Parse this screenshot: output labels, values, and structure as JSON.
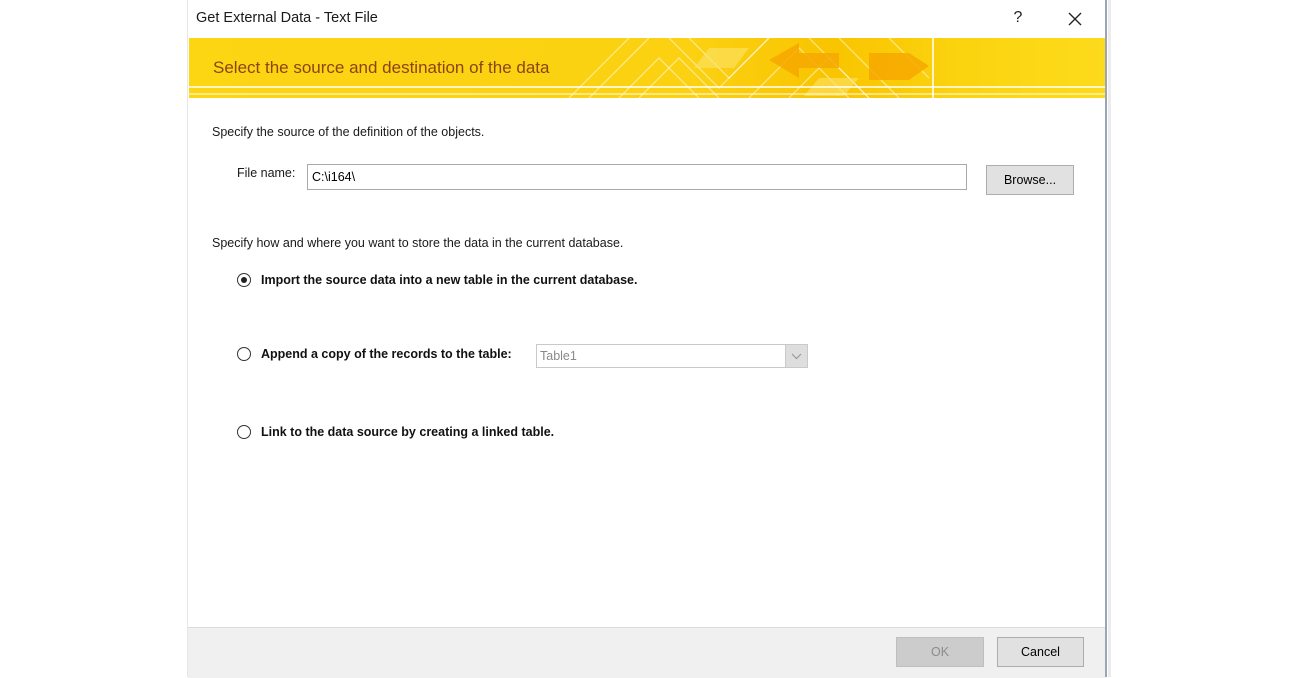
{
  "window": {
    "title": "Get External Data - Text File",
    "help_label": "?"
  },
  "banner": {
    "title": "Select the source and destination of the data"
  },
  "source": {
    "instruction": "Specify the source of the definition of the objects.",
    "file_label": "File name:",
    "file_value": "C:\\i164\\",
    "browse_label": "Browse..."
  },
  "destination": {
    "instruction": "Specify how and where you want to store the data in the current database.",
    "options": [
      {
        "label": "Import the source data into a new table in the current database.",
        "selected": true
      },
      {
        "label": "Append a copy of the records to the table:",
        "selected": false
      },
      {
        "label": "Link to the data source by creating a linked table.",
        "selected": false
      }
    ],
    "append_table": "Table1"
  },
  "footer": {
    "ok_label": "OK",
    "cancel_label": "Cancel"
  },
  "colors": {
    "banner": "#fcd513",
    "banner_title": "#8a4513",
    "footer": "#f0f0f0"
  }
}
